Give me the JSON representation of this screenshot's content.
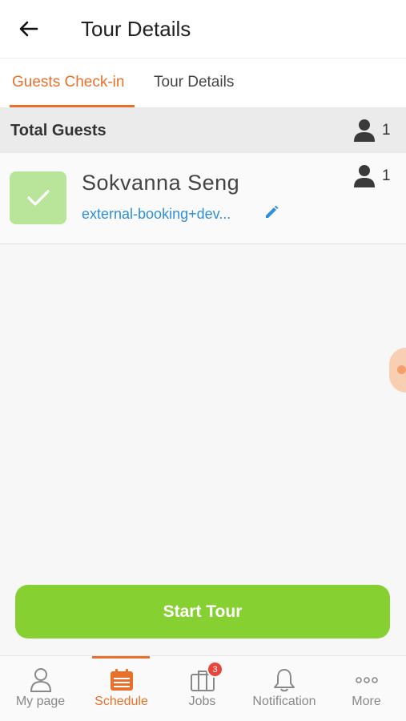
{
  "header": {
    "title": "Tour Details"
  },
  "tabs": [
    {
      "label": "Guests Check-in",
      "active": true
    },
    {
      "label": "Tour Details",
      "active": false
    }
  ],
  "summary": {
    "label": "Total Guests",
    "count": "1"
  },
  "guests": [
    {
      "name": "Sokvanna Seng",
      "email": "external-booking+dev...",
      "count": "1",
      "checked_in": true
    }
  ],
  "actions": {
    "start_label": "Start Tour"
  },
  "nav": [
    {
      "label": "My page",
      "icon": "user-icon",
      "active": false
    },
    {
      "label": "Schedule",
      "icon": "calendar-icon",
      "active": true
    },
    {
      "label": "Jobs",
      "icon": "briefcase-icon",
      "active": false,
      "badge": "3"
    },
    {
      "label": "Notification",
      "icon": "bell-icon",
      "active": false
    },
    {
      "label": "More",
      "icon": "more-icon",
      "active": false
    }
  ],
  "colors": {
    "accent": "#e8702a",
    "primary_button": "#86d131",
    "checkbox": "#b8e59a",
    "link": "#2f8fd8"
  }
}
